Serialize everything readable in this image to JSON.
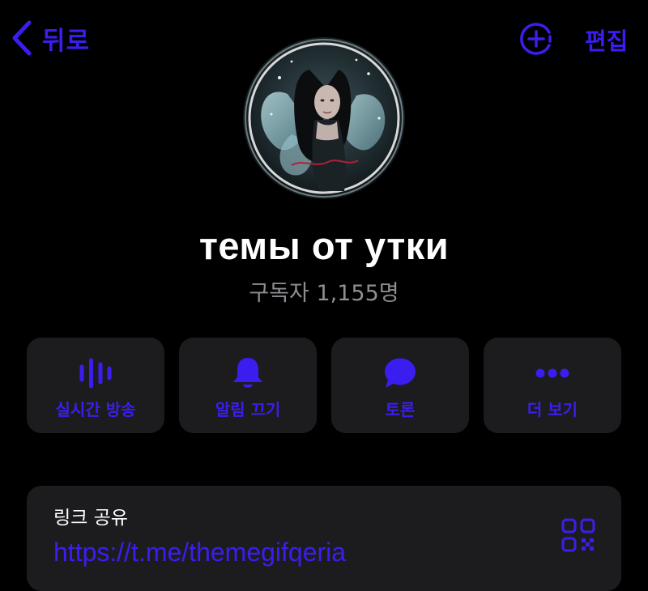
{
  "colors": {
    "background": "#000000",
    "accent": "#3a1ef0",
    "card": "#1c1c1e",
    "secondary_text": "#8e8e93",
    "primary_text": "#ffffff"
  },
  "header": {
    "back_label": "뒤로",
    "back_icon": "chevron-left-icon",
    "add_icon": "circle-plus-icon",
    "edit_label": "편집"
  },
  "profile": {
    "avatar_icon": "channel-avatar",
    "name": "темы от утки",
    "subscribers": "구독자 1,155명"
  },
  "actions": [
    {
      "label": "실시간 방송",
      "icon": "live-stream-icon"
    },
    {
      "label": "알림 끄기",
      "icon": "bell-icon"
    },
    {
      "label": "토론",
      "icon": "chat-bubble-icon"
    },
    {
      "label": "더 보기",
      "icon": "more-icon"
    }
  ],
  "link_share": {
    "caption": "링크 공유",
    "url": "https://t.me/themegifqeria",
    "qr_icon": "qr-code-icon"
  }
}
